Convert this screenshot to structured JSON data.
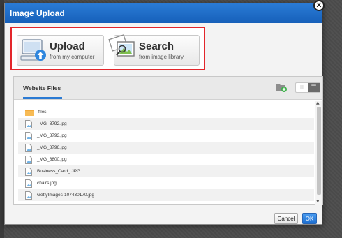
{
  "dialog": {
    "title": "Image Upload",
    "close_icon": "close-icon"
  },
  "upload_options": {
    "upload": {
      "title": "Upload",
      "subtitle": "from my computer",
      "icon": "computer-upload-icon"
    },
    "search": {
      "title": "Search",
      "subtitle": "from image library",
      "icon": "image-library-icon"
    }
  },
  "files_panel": {
    "tab_label": "Website Files",
    "new_folder_icon": "new-folder-icon",
    "view_toggle": {
      "grid_icon": "grid-view-icon",
      "list_icon": "list-view-icon",
      "active": "list"
    },
    "items": [
      {
        "name": "files",
        "type": "folder"
      },
      {
        "name": "_MG_8792.jpg",
        "type": "file"
      },
      {
        "name": "_MG_8793.jpg",
        "type": "file"
      },
      {
        "name": "_MG_8796.jpg",
        "type": "file"
      },
      {
        "name": "_MG_8800.jpg",
        "type": "file"
      },
      {
        "name": "Business_Card_.JPG",
        "type": "file"
      },
      {
        "name": "chairs.jpg",
        "type": "file"
      },
      {
        "name": "GettyImages-107430170.jpg",
        "type": "file"
      }
    ]
  },
  "footer": {
    "cancel_label": "Cancel",
    "ok_label": "OK"
  },
  "colors": {
    "titlebar": "#1f6fcb",
    "highlight_border": "#e3262b",
    "ok_button": "#2a7ad6",
    "folder": "#f2a93b"
  }
}
